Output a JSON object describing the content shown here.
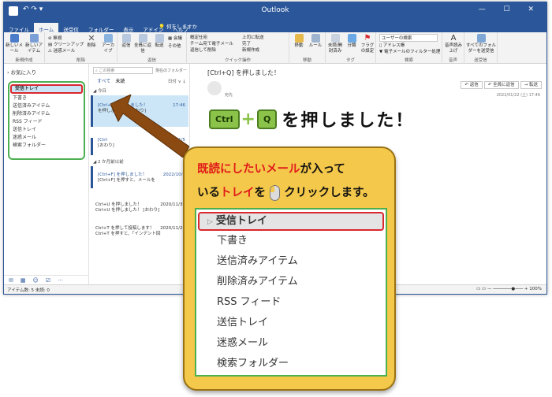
{
  "window": {
    "title": "Outlook",
    "quick_access": "↶  ↷  ▾",
    "controls": "—  ☐  ✕"
  },
  "tabs": [
    "ファイル",
    "ホーム",
    "送受信",
    "フォルダー",
    "表示",
    "アドイン",
    "ヘルプ"
  ],
  "tell_me": "何をしますか",
  "ribbon": {
    "groups": [
      "新規作成",
      "削除",
      "返信",
      "クイック操作",
      "移動",
      "タグ",
      "検索",
      "音声",
      "送受信"
    ],
    "buttons": {
      "new_mail": "新しいメール",
      "new_item": "新しいアイテム",
      "ignore": "無視",
      "cleanup": "クリーンアップ",
      "junk": "迷惑メール",
      "delete": "削除",
      "archive": "アーカイブ",
      "reply": "返信",
      "reply_all": "全員に返信",
      "forward": "転送",
      "meeting": "会議",
      "im": "その他",
      "quick1": "概定仕宛",
      "quick2": "チーム宛て電子メール",
      "quick3": "返信して削除",
      "quick4": "上司に転送",
      "quick5": "完了",
      "quick6": "新規作成",
      "move": "移動",
      "rules": "ルール",
      "unread": "未読/開封済み",
      "categorize": "分類",
      "followup": "フラグの設定",
      "search_people": "ユーザーの検索",
      "address_book": "アドレス帳",
      "filter_mail": "電子メールのフィルター処理",
      "read_aloud": "音声読み上げ",
      "send_receive_all": "すべてのフォルダーを送受信"
    }
  },
  "folders": {
    "favorites": "› お気に入り",
    "items": [
      "受信トレイ",
      "下書き",
      "送信済みアイテム",
      "削除済みアイテム",
      "RSS フィード",
      "送信トレイ",
      "迷惑メール",
      "検索フォルダー"
    ]
  },
  "nav_icons": [
    "mail-icon",
    "calendar-icon",
    "people-icon",
    "tasks-icon",
    "more-icon"
  ],
  "message_list": {
    "search_placeholder": "この検索",
    "search_scope": "現在のフォルダー",
    "filter_all": "すべて",
    "filter_unread": "未読",
    "sort": "日付 ∨  ↓",
    "group_today": "◢ 今日",
    "group_older": "◢ 2 か月前以前",
    "messages": [
      {
        "subject": "[Ctrl+Q] を押しました！",
        "date": "17:46",
        "preview": "を押しました！ [おわり]"
      },
      {
        "subject": "[Ctrl",
        "date": "2020/01/5",
        "preview": "[おわり]"
      },
      {
        "subject": "[Ctrl+F] を押しました！",
        "date": "2022/10/8",
        "preview": "[Ctrl+F] を押すと、メールを"
      },
      {
        "subject": "Ctrl+U を押しました！",
        "date": "2020/11/30",
        "preview": "Ctrl+U を押しました！ [おわり]"
      },
      {
        "subject": "Ctrl+T を押して投稿します！",
        "date": "2020/11/20",
        "preview": "Ctrl+T を押すと、「インデント回"
      }
    ]
  },
  "reading": {
    "subject": "[Ctrl+Q] を押しました！",
    "sender": "宛先",
    "reply": "↶ 返信",
    "reply_all": "↶ 全員に返信",
    "forward": "→ 転送",
    "date": "2022/01/22 (土) 17:46",
    "key1": "Ctrl",
    "plus": "+",
    "key2": "Q",
    "headline": "を押しました！"
  },
  "status": {
    "left": "アイテム数: 5    未読: 0",
    "right": "▭  ▭  —  ───────●───  +  100%"
  },
  "callout": {
    "line1_red": "既読にしたいメール",
    "line1_black": "が入って",
    "line2_black": "いる",
    "line2_red": "トレイ",
    "line2_after": "を",
    "line2_end": "クリックします。",
    "items": [
      "受信トレイ",
      "下書き",
      "送信済みアイテム",
      "削除済みアイテム",
      "RSS フィード",
      "送信トレイ",
      "迷惑メール",
      "検索フォルダー"
    ],
    "tri": "▷"
  },
  "colors": {
    "accent": "#2b579a",
    "highlight_red": "#d9282f",
    "highlight_green": "#4caf50",
    "callout": "#f4c84a",
    "key_green": "#8bc34a"
  }
}
